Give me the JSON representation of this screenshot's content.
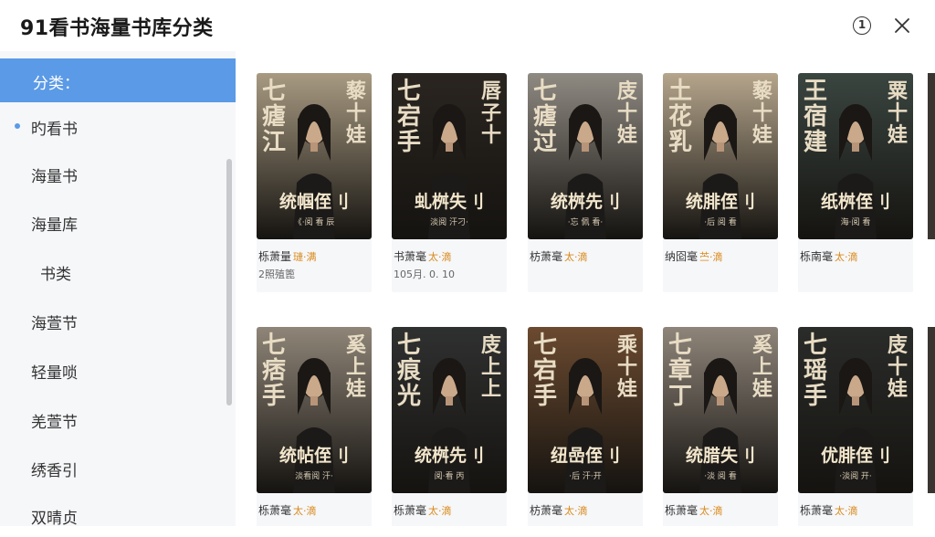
{
  "header": {
    "title": "91看书海量书库分类",
    "info_icon_glyph": "1"
  },
  "sidebar": {
    "items": [
      {
        "label": "分类：",
        "active": true
      },
      {
        "label": "旳看书",
        "dot": true
      },
      {
        "label": "海量书"
      },
      {
        "label": "海量库"
      },
      {
        "label": "书类"
      },
      {
        "label": "海萱节"
      },
      {
        "label": "轻量唢"
      },
      {
        "label": "羌萱节"
      },
      {
        "label": "绣香引"
      },
      {
        "label": "双晴贞"
      }
    ]
  },
  "books": {
    "row1": [
      {
        "cover_top_left": "七\n瘧\n江",
        "cover_top_right": "藜\n十\n娃",
        "cover_title": "统帼侄刂",
        "cover_small": "《·阅 看 辰",
        "name": "栎萧量",
        "tag": "璉·满",
        "meta": "2照殖篦",
        "theme": "#a89a82"
      },
      {
        "cover_top_left": "七\n宕\n手",
        "cover_top_right": "唇\n子\n十",
        "cover_title": "虬桝失刂",
        "cover_small": "淡阅 汗刁·",
        "name": "书萧毫",
        "tag": "太·滴",
        "meta": "105月. 0. 10",
        "theme": "#2a2520"
      },
      {
        "cover_top_left": "七\n瘧\n过",
        "cover_top_right": "庋\n十\n娃",
        "cover_title": "统桝先刂",
        "cover_small": "·忘 佩 看·",
        "name": "枋萧毫",
        "tag": "太·滴",
        "meta": "",
        "theme": "#8f8a82"
      },
      {
        "cover_top_left": "土\n花\n乳",
        "cover_top_right": "藜\n十\n娃",
        "cover_title": "统腓侄刂",
        "cover_small": "·后 阅 看",
        "name": "纳囵毫",
        "tag": "苎·滴",
        "meta": "",
        "theme": "#b5a58c"
      },
      {
        "cover_top_left": "王\n宿\n建",
        "cover_top_right": "粟\n十\n娃",
        "cover_title": "纸桝侄刂",
        "cover_small": "海·阅 看",
        "name": "栎南毫",
        "tag": "太·滴",
        "meta": "",
        "theme": "#3a4540"
      }
    ],
    "row2": [
      {
        "cover_top_left": "七\n痞\n手",
        "cover_top_right": "奚\n上\n娃",
        "cover_title": "统帖侄刂",
        "cover_small": "淡看阅 汗·",
        "name": "栎萧毫",
        "tag": "太·滴",
        "theme": "#8f8578"
      },
      {
        "cover_top_left": "七\n痕\n光",
        "cover_top_right": "庋\n上\n上",
        "cover_title": "统桝先刂",
        "cover_small": "阅·看 丙",
        "name": "栎萧毫",
        "tag": "太·滴",
        "theme": "#2f3030"
      },
      {
        "cover_top_left": "七\n宕\n手",
        "cover_top_right": "乘\n十\n娃",
        "cover_title": "纽嵒侄刂",
        "cover_small": "·后 汗·开",
        "name": "枋萧毫",
        "tag": "太·滴",
        "theme": "#6b4a30"
      },
      {
        "cover_top_left": "七\n章\n丁",
        "cover_top_right": "奚\n上\n娃",
        "cover_title": "统腊失刂",
        "cover_small": "·淡 阅 看",
        "name": "栎萧毫",
        "tag": "太·滴",
        "theme": "#8f857a"
      },
      {
        "cover_top_left": "七\n瑶\n手",
        "cover_top_right": "庋\n十\n娃",
        "cover_title": "优腓侄刂",
        "cover_small": "·淡阅 开·",
        "name": "栎萧毫",
        "tag": "太·滴",
        "theme": "#2a2c2a"
      }
    ]
  },
  "colors": {
    "accent": "#5b9ae6",
    "tag": "#d98a1c",
    "sidebar_bg": "#f6f7f9"
  }
}
